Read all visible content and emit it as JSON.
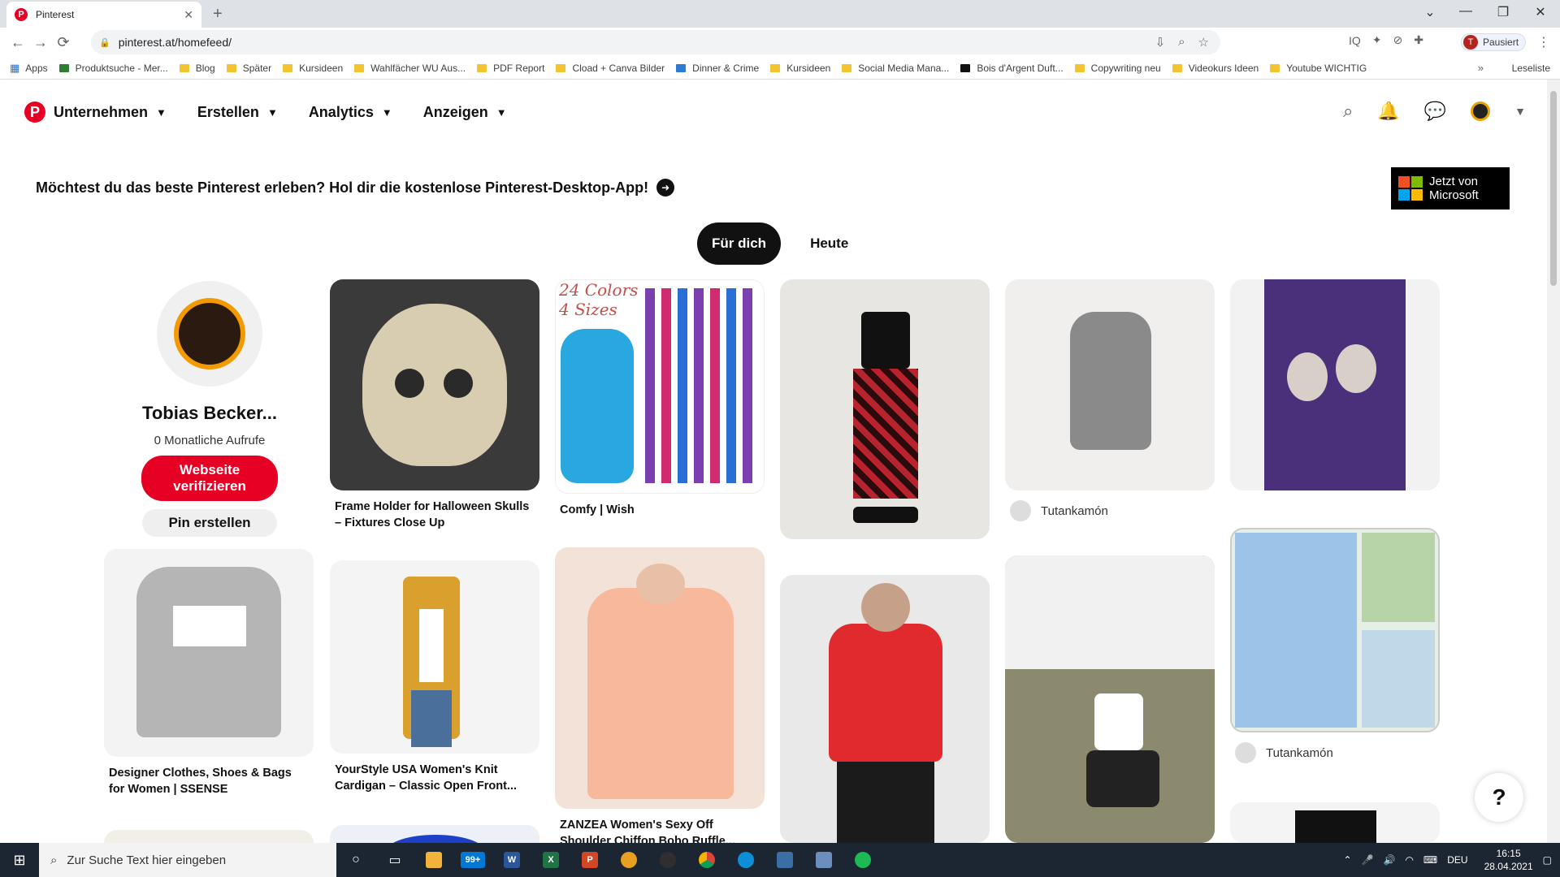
{
  "browser": {
    "tab_title": "Pinterest",
    "url": "pinterest.at/homefeed/",
    "profile_label": "Pausiert",
    "profile_initial": "T",
    "bookmarks": [
      {
        "label": "Apps"
      },
      {
        "label": "Produktsuche - Mer..."
      },
      {
        "label": "Blog"
      },
      {
        "label": "Später"
      },
      {
        "label": "Kursideen"
      },
      {
        "label": "Wahlfächer WU Aus..."
      },
      {
        "label": "PDF Report"
      },
      {
        "label": "Cload + Canva Bilder"
      },
      {
        "label": "Dinner & Crime"
      },
      {
        "label": "Kursideen"
      },
      {
        "label": "Social Media Mana..."
      },
      {
        "label": "Bois d'Argent Duft..."
      },
      {
        "label": "Copywriting neu"
      },
      {
        "label": "Videokurs Ideen"
      },
      {
        "label": "Youtube WICHTIG"
      }
    ],
    "reading_list": "Leseliste"
  },
  "nav": {
    "items": [
      "Unternehmen",
      "Erstellen",
      "Analytics",
      "Anzeigen"
    ]
  },
  "banner": {
    "text": "Möchtest du das beste Pinterest erleben? Hol dir die kostenlose Pinterest-Desktop-App!",
    "ms_line1": "Jetzt von",
    "ms_line2": "Microsoft"
  },
  "feed_tabs": [
    "Für dich",
    "Heute"
  ],
  "profile": {
    "name": "Tobias Becker...",
    "views": "0 Monatliche Aufrufe",
    "verify_label_1": "Webseite",
    "verify_label_2": "verifizieren",
    "create_pin_label": "Pin erstellen"
  },
  "pins": [
    {
      "caption": "Frame Holder for Halloween Skulls – Fixtures Close Up"
    },
    {
      "caption": "Comfy | Wish",
      "image_text_1": "24 Colors",
      "image_text_2": "4 Sizes"
    },
    {
      "caption": ""
    },
    {
      "author": "Tutankamón"
    },
    {
      "caption": ""
    },
    {
      "caption": "Designer Clothes, Shoes & Bags for Women | SSENSE"
    },
    {
      "caption": "YourStyle USA Women's Knit Cardigan – Classic Open Front..."
    },
    {
      "caption": "ZANZEA Women's Sexy Off Shoulder Chiffon Boho Ruffle..."
    },
    {
      "caption": ""
    },
    {
      "caption": ""
    },
    {
      "author": "Tutankamón"
    }
  ],
  "help_label": "?",
  "taskbar": {
    "search_placeholder": "Zur Suche Text hier eingeben",
    "mail_badge": "99+",
    "lang": "DEU",
    "time": "16:15",
    "date": "28.04.2021"
  },
  "colors": {
    "brand": "#e60023",
    "taskbar": "#1c2532"
  }
}
